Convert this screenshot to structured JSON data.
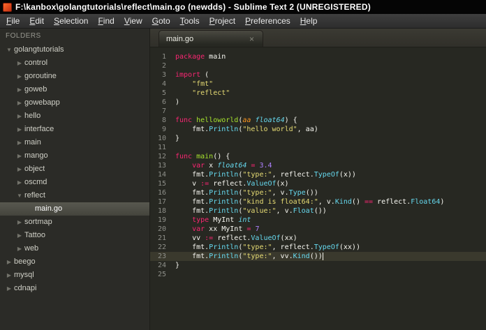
{
  "window": {
    "title": "F:\\kanbox\\golangtutorials\\reflect\\main.go (newdds) - Sublime Text 2 (UNREGISTERED)"
  },
  "theme": {
    "editor_background": "#272822",
    "keyword": "#f92672",
    "string": "#e6db74",
    "number": "#ae81ff",
    "function_def": "#a6e22e",
    "type_italic": "#66d9ef",
    "call": "#66d9ef",
    "plain_text": "#f8f8f2",
    "line_number": "#8f908a",
    "app_icon": "#d9431d"
  },
  "menu": {
    "items": [
      "File",
      "Edit",
      "Selection",
      "Find",
      "View",
      "Goto",
      "Tools",
      "Project",
      "Preferences",
      "Help"
    ]
  },
  "sidebar": {
    "header": "FOLDERS",
    "items": [
      {
        "label": "golangtutorials",
        "level": 0,
        "kind": "folder",
        "expanded": true,
        "selected": false
      },
      {
        "label": "control",
        "level": 1,
        "kind": "folder",
        "expanded": false,
        "selected": false
      },
      {
        "label": "goroutine",
        "level": 1,
        "kind": "folder",
        "expanded": false,
        "selected": false
      },
      {
        "label": "goweb",
        "level": 1,
        "kind": "folder",
        "expanded": false,
        "selected": false
      },
      {
        "label": "gowebapp",
        "level": 1,
        "kind": "folder",
        "expanded": false,
        "selected": false
      },
      {
        "label": "hello",
        "level": 1,
        "kind": "folder",
        "expanded": false,
        "selected": false
      },
      {
        "label": "interface",
        "level": 1,
        "kind": "folder",
        "expanded": false,
        "selected": false
      },
      {
        "label": "main",
        "level": 1,
        "kind": "folder",
        "expanded": false,
        "selected": false
      },
      {
        "label": "mango",
        "level": 1,
        "kind": "folder",
        "expanded": false,
        "selected": false
      },
      {
        "label": "object",
        "level": 1,
        "kind": "folder",
        "expanded": false,
        "selected": false
      },
      {
        "label": "oscmd",
        "level": 1,
        "kind": "folder",
        "expanded": false,
        "selected": false
      },
      {
        "label": "reflect",
        "level": 1,
        "kind": "folder",
        "expanded": true,
        "selected": false
      },
      {
        "label": "main.go",
        "level": 2,
        "kind": "file",
        "expanded": false,
        "selected": true
      },
      {
        "label": "sortmap",
        "level": 1,
        "kind": "folder",
        "expanded": false,
        "selected": false
      },
      {
        "label": "Tattoo",
        "level": 1,
        "kind": "folder",
        "expanded": false,
        "selected": false
      },
      {
        "label": "web",
        "level": 1,
        "kind": "folder",
        "expanded": false,
        "selected": false
      },
      {
        "label": "beego",
        "level": 0,
        "kind": "folder",
        "expanded": false,
        "selected": false
      },
      {
        "label": "mysql",
        "level": 0,
        "kind": "folder",
        "expanded": false,
        "selected": false
      },
      {
        "label": "cdnapi",
        "level": 0,
        "kind": "folder",
        "expanded": false,
        "selected": false
      }
    ]
  },
  "editor": {
    "tab": {
      "label": "main.go",
      "close": "×"
    },
    "lines": [
      {
        "num": 1,
        "tokens": [
          {
            "t": "package",
            "c": "kw"
          },
          {
            "t": " main",
            "c": "pl"
          }
        ]
      },
      {
        "num": 2,
        "tokens": []
      },
      {
        "num": 3,
        "tokens": [
          {
            "t": "import",
            "c": "kw"
          },
          {
            "t": " (",
            "c": "pl"
          }
        ]
      },
      {
        "num": 4,
        "tokens": [
          {
            "t": "    ",
            "c": "pl"
          },
          {
            "t": "\"fmt\"",
            "c": "st"
          }
        ]
      },
      {
        "num": 5,
        "tokens": [
          {
            "t": "    ",
            "c": "pl"
          },
          {
            "t": "\"reflect\"",
            "c": "st"
          }
        ]
      },
      {
        "num": 6,
        "tokens": [
          {
            "t": ")",
            "c": "pl"
          }
        ]
      },
      {
        "num": 7,
        "tokens": []
      },
      {
        "num": 8,
        "tokens": [
          {
            "t": "func",
            "c": "kw"
          },
          {
            "t": " ",
            "c": "pl"
          },
          {
            "t": "helloworld",
            "c": "fn"
          },
          {
            "t": "(",
            "c": "pl"
          },
          {
            "t": "aa",
            "c": "pa"
          },
          {
            "t": " ",
            "c": "pl"
          },
          {
            "t": "float64",
            "c": "ty"
          },
          {
            "t": ") {",
            "c": "pl"
          }
        ]
      },
      {
        "num": 9,
        "tokens": [
          {
            "t": "    fmt.",
            "c": "pl"
          },
          {
            "t": "Println",
            "c": "ca"
          },
          {
            "t": "(",
            "c": "pl"
          },
          {
            "t": "\"hello world\"",
            "c": "st"
          },
          {
            "t": ", aa)",
            "c": "pl"
          }
        ]
      },
      {
        "num": 10,
        "tokens": [
          {
            "t": "}",
            "c": "pl"
          }
        ]
      },
      {
        "num": 11,
        "tokens": []
      },
      {
        "num": 12,
        "tokens": [
          {
            "t": "func",
            "c": "kw"
          },
          {
            "t": " ",
            "c": "pl"
          },
          {
            "t": "main",
            "c": "fn"
          },
          {
            "t": "() {",
            "c": "pl"
          }
        ]
      },
      {
        "num": 13,
        "tokens": [
          {
            "t": "    ",
            "c": "pl"
          },
          {
            "t": "var",
            "c": "kw"
          },
          {
            "t": " x ",
            "c": "pl"
          },
          {
            "t": "float64",
            "c": "ty"
          },
          {
            "t": " ",
            "c": "pl"
          },
          {
            "t": "=",
            "c": "kw"
          },
          {
            "t": " ",
            "c": "pl"
          },
          {
            "t": "3.4",
            "c": "nu"
          }
        ]
      },
      {
        "num": 14,
        "tokens": [
          {
            "t": "    fmt.",
            "c": "pl"
          },
          {
            "t": "Println",
            "c": "ca"
          },
          {
            "t": "(",
            "c": "pl"
          },
          {
            "t": "\"type:\"",
            "c": "st"
          },
          {
            "t": ", reflect.",
            "c": "pl"
          },
          {
            "t": "TypeOf",
            "c": "ca"
          },
          {
            "t": "(x))",
            "c": "pl"
          }
        ]
      },
      {
        "num": 15,
        "tokens": [
          {
            "t": "    v ",
            "c": "pl"
          },
          {
            "t": ":=",
            "c": "kw"
          },
          {
            "t": " reflect.",
            "c": "pl"
          },
          {
            "t": "ValueOf",
            "c": "ca"
          },
          {
            "t": "(x)",
            "c": "pl"
          }
        ]
      },
      {
        "num": 16,
        "tokens": [
          {
            "t": "    fmt.",
            "c": "pl"
          },
          {
            "t": "Println",
            "c": "ca"
          },
          {
            "t": "(",
            "c": "pl"
          },
          {
            "t": "\"type:\"",
            "c": "st"
          },
          {
            "t": ", v.",
            "c": "pl"
          },
          {
            "t": "Type",
            "c": "ca"
          },
          {
            "t": "())",
            "c": "pl"
          }
        ]
      },
      {
        "num": 17,
        "tokens": [
          {
            "t": "    fmt.",
            "c": "pl"
          },
          {
            "t": "Println",
            "c": "ca"
          },
          {
            "t": "(",
            "c": "pl"
          },
          {
            "t": "\"kind is float64:\"",
            "c": "st"
          },
          {
            "t": ", v.",
            "c": "pl"
          },
          {
            "t": "Kind",
            "c": "ca"
          },
          {
            "t": "() ",
            "c": "pl"
          },
          {
            "t": "==",
            "c": "kw"
          },
          {
            "t": " reflect.",
            "c": "pl"
          },
          {
            "t": "Float64",
            "c": "ca"
          },
          {
            "t": ")",
            "c": "pl"
          }
        ]
      },
      {
        "num": 18,
        "tokens": [
          {
            "t": "    fmt.",
            "c": "pl"
          },
          {
            "t": "Println",
            "c": "ca"
          },
          {
            "t": "(",
            "c": "pl"
          },
          {
            "t": "\"value:\"",
            "c": "st"
          },
          {
            "t": ", v.",
            "c": "pl"
          },
          {
            "t": "Float",
            "c": "ca"
          },
          {
            "t": "())",
            "c": "pl"
          }
        ]
      },
      {
        "num": 19,
        "tokens": [
          {
            "t": "    ",
            "c": "pl"
          },
          {
            "t": "type",
            "c": "kw"
          },
          {
            "t": " MyInt ",
            "c": "pl"
          },
          {
            "t": "int",
            "c": "ty"
          }
        ]
      },
      {
        "num": 20,
        "tokens": [
          {
            "t": "    ",
            "c": "pl"
          },
          {
            "t": "var",
            "c": "kw"
          },
          {
            "t": " xx MyInt ",
            "c": "pl"
          },
          {
            "t": "=",
            "c": "kw"
          },
          {
            "t": " ",
            "c": "pl"
          },
          {
            "t": "7",
            "c": "nu"
          }
        ]
      },
      {
        "num": 21,
        "tokens": [
          {
            "t": "    vv ",
            "c": "pl"
          },
          {
            "t": ":=",
            "c": "kw"
          },
          {
            "t": " reflect.",
            "c": "pl"
          },
          {
            "t": "ValueOf",
            "c": "ca"
          },
          {
            "t": "(xx)",
            "c": "pl"
          }
        ]
      },
      {
        "num": 22,
        "tokens": [
          {
            "t": "    fmt.",
            "c": "pl"
          },
          {
            "t": "Println",
            "c": "ca"
          },
          {
            "t": "(",
            "c": "pl"
          },
          {
            "t": "\"type:\"",
            "c": "st"
          },
          {
            "t": ", reflect.",
            "c": "pl"
          },
          {
            "t": "TypeOf",
            "c": "ca"
          },
          {
            "t": "(xx))",
            "c": "pl"
          }
        ]
      },
      {
        "num": 23,
        "tokens": [
          {
            "t": "    fmt.",
            "c": "pl"
          },
          {
            "t": "Println",
            "c": "ca"
          },
          {
            "t": "(",
            "c": "pl"
          },
          {
            "t": "\"type:\"",
            "c": "st"
          },
          {
            "t": ", vv.",
            "c": "pl"
          },
          {
            "t": "Kind",
            "c": "ca"
          },
          {
            "t": "())",
            "c": "pl"
          }
        ],
        "current": true,
        "cursor": true
      },
      {
        "num": 24,
        "tokens": [
          {
            "t": "}",
            "c": "pl"
          }
        ]
      },
      {
        "num": 25,
        "tokens": []
      }
    ]
  }
}
